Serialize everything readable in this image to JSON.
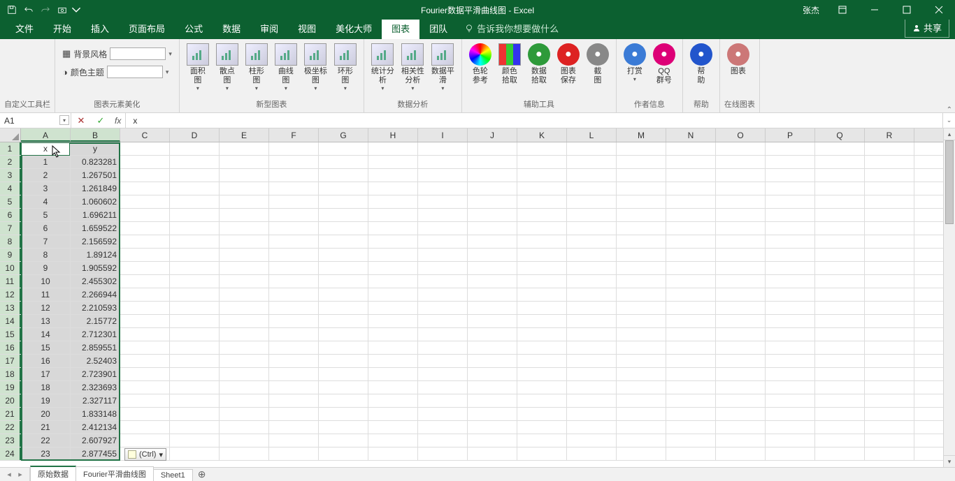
{
  "titlebar": {
    "title": "Fourier数据平滑曲线图 - Excel",
    "user": "张杰"
  },
  "menu": {
    "tabs": [
      "文件",
      "开始",
      "插入",
      "页面布局",
      "公式",
      "数据",
      "审阅",
      "视图",
      "美化大师",
      "图表",
      "团队"
    ],
    "active_index": 9,
    "tellme": "告诉我你想要做什么",
    "share": "共享"
  },
  "ribbon": {
    "groups": [
      {
        "label": "自定义工具栏",
        "items": []
      },
      {
        "label": "图表元素美化",
        "forms": [
          {
            "icon": "grid-icon",
            "text": "背景风格"
          },
          {
            "icon": "palette-icon",
            "text": "颜色主题"
          }
        ]
      },
      {
        "label": "新型图表",
        "buttons": [
          {
            "name": "area-chart-btn",
            "label": "面积\n图",
            "drop": true
          },
          {
            "name": "scatter-chart-btn",
            "label": "散点\n图",
            "drop": true
          },
          {
            "name": "bar-chart-btn",
            "label": "柱形\n图",
            "drop": true
          },
          {
            "name": "curve-chart-btn",
            "label": "曲线\n图",
            "drop": true
          },
          {
            "name": "polar-chart-btn",
            "label": "极坐标\n图",
            "drop": true
          },
          {
            "name": "ring-chart-btn",
            "label": "环形\n图",
            "drop": true
          }
        ]
      },
      {
        "label": "数据分析",
        "buttons": [
          {
            "name": "stat-analysis-btn",
            "label": "统计分\n析",
            "drop": true
          },
          {
            "name": "corr-analysis-btn",
            "label": "相关性\n分析",
            "drop": true
          },
          {
            "name": "data-smooth-btn",
            "label": "数据平\n滑",
            "drop": true
          }
        ]
      },
      {
        "label": "辅助工具",
        "buttons": [
          {
            "name": "colorwheel-ref-btn",
            "label": "色轮\n参考",
            "color": "conic"
          },
          {
            "name": "color-pick-btn",
            "label": "颜色\n拾取",
            "color": "squares"
          },
          {
            "name": "data-pick-btn",
            "label": "数据\n拾取",
            "color": "#2e9a3a"
          },
          {
            "name": "chart-save-btn",
            "label": "图表\n保存",
            "color": "#d22"
          },
          {
            "name": "screenshot-btn",
            "label": "截\n图",
            "color": "#888"
          }
        ]
      },
      {
        "label": "作者信息",
        "buttons": [
          {
            "name": "reward-btn",
            "label": "打赏",
            "drop": true,
            "color": "#3b7bd6"
          },
          {
            "name": "qq-group-btn",
            "label": "QQ\n群号",
            "color": "#d07"
          }
        ]
      },
      {
        "label": "帮助",
        "buttons": [
          {
            "name": "help-btn",
            "label": "帮\n助",
            "color": "#2255cc"
          }
        ]
      },
      {
        "label": "在线图表",
        "buttons": [
          {
            "name": "online-chart-btn",
            "label": "图表",
            "color": "#c77"
          }
        ]
      }
    ]
  },
  "namebox": "A1",
  "formula_value": "x",
  "columns": [
    "A",
    "B",
    "C",
    "D",
    "E",
    "F",
    "G",
    "H",
    "I",
    "J",
    "K",
    "L",
    "M",
    "N",
    "O",
    "P",
    "Q",
    "R"
  ],
  "selected_cols": [
    "A",
    "B"
  ],
  "paste_options_label": "(Ctrl)",
  "sheet_tabs": [
    "原始数据",
    "Fourier平滑曲线图",
    "Sheet1"
  ],
  "active_sheet_index": 0,
  "chart_data": {
    "type": "table",
    "columns": [
      "x",
      "y"
    ],
    "rows": [
      [
        1,
        0.823281
      ],
      [
        2,
        1.267501
      ],
      [
        3,
        1.261849
      ],
      [
        4,
        1.060602
      ],
      [
        5,
        1.696211
      ],
      [
        6,
        1.659522
      ],
      [
        7,
        2.156592
      ],
      [
        8,
        1.89124
      ],
      [
        9,
        1.905592
      ],
      [
        10,
        2.455302
      ],
      [
        11,
        2.266944
      ],
      [
        12,
        2.210593
      ],
      [
        13,
        2.15772
      ],
      [
        14,
        2.712301
      ],
      [
        15,
        2.859551
      ],
      [
        16,
        2.52403
      ],
      [
        17,
        2.723901
      ],
      [
        18,
        2.323693
      ],
      [
        19,
        2.327117
      ],
      [
        20,
        1.833148
      ],
      [
        21,
        2.412134
      ],
      [
        22,
        2.607927
      ],
      [
        23,
        2.877455
      ]
    ]
  }
}
